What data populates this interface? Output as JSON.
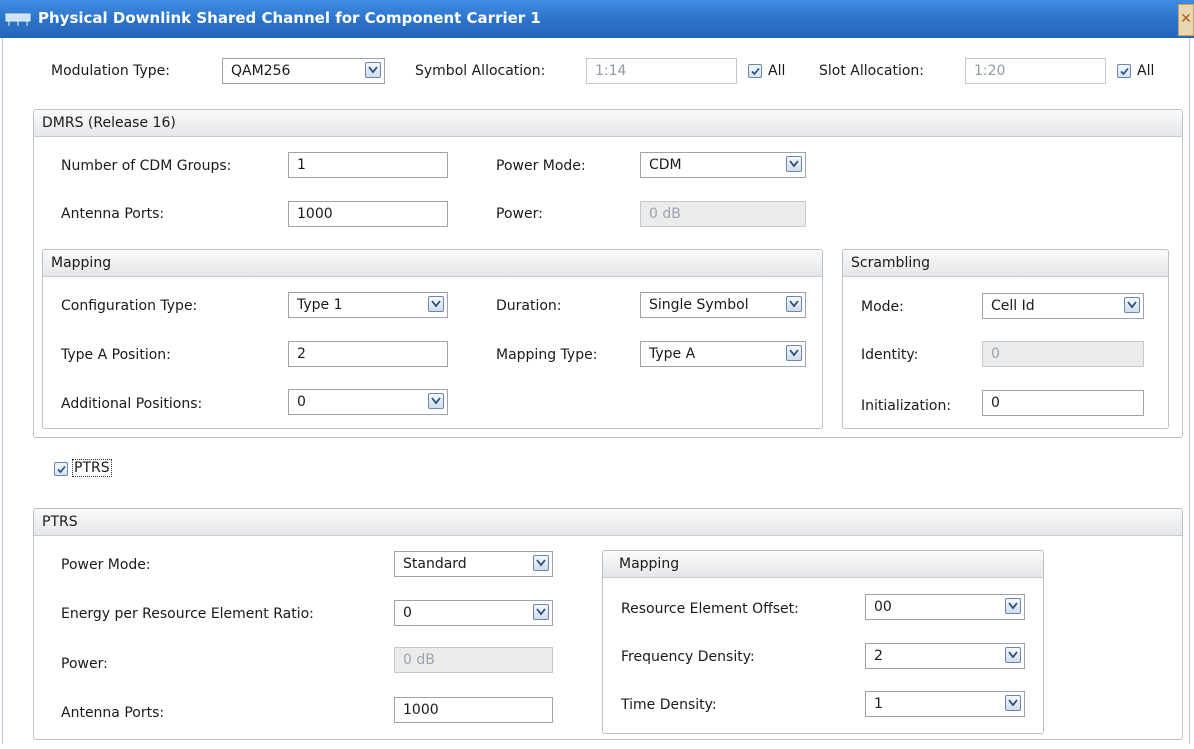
{
  "window": {
    "title": "Physical Downlink Shared Channel for Component Carrier 1",
    "close_glyph": "✕"
  },
  "top": {
    "modulation_label": "Modulation Type:",
    "modulation_value": "QAM256",
    "symbol_label": "Symbol Allocation:",
    "symbol_value": "1:14",
    "symbol_all_label": "All",
    "slot_label": "Slot Allocation:",
    "slot_value": "1:20",
    "slot_all_label": "All"
  },
  "dmrs": {
    "title": "DMRS (Release 16)",
    "cdm_groups_label": "Number of CDM Groups:",
    "cdm_groups_value": "1",
    "power_mode_label": "Power Mode:",
    "power_mode_value": "CDM",
    "antenna_ports_label": "Antenna Ports:",
    "antenna_ports_value": "1000",
    "power_label": "Power:",
    "power_value": "0 dB",
    "mapping": {
      "title": "Mapping",
      "config_type_label": "Configuration Type:",
      "config_type_value": "Type 1",
      "duration_label": "Duration:",
      "duration_value": "Single Symbol",
      "type_a_position_label": "Type A Position:",
      "type_a_position_value": "2",
      "mapping_type_label": "Mapping Type:",
      "mapping_type_value": "Type A",
      "additional_positions_label": "Additional Positions:",
      "additional_positions_value": "0"
    },
    "scrambling": {
      "title": "Scrambling",
      "mode_label": "Mode:",
      "mode_value": "Cell Id",
      "identity_label": "Identity:",
      "identity_value": "0",
      "initialization_label": "Initialization:",
      "initialization_value": "0"
    }
  },
  "ptrs_toggle": {
    "label": "PTRS",
    "checked": true
  },
  "ptrs": {
    "title": "PTRS",
    "power_mode_label": "Power Mode:",
    "power_mode_value": "Standard",
    "epre_label": "Energy per Resource Element Ratio:",
    "epre_value": "0",
    "power_label": "Power:",
    "power_value": "0 dB",
    "antenna_ports_label": "Antenna Ports:",
    "antenna_ports_value": "1000",
    "mapping": {
      "title": "Mapping",
      "re_offset_label": "Resource Element Offset:",
      "re_offset_value": "00",
      "freq_density_label": "Frequency Density:",
      "freq_density_value": "2",
      "time_density_label": "Time Density:",
      "time_density_value": "1"
    }
  },
  "colors": {
    "title_bar": "#2b72c8",
    "disabled_field": "#ebebeb",
    "checkbox_border": "#6a86a8"
  }
}
